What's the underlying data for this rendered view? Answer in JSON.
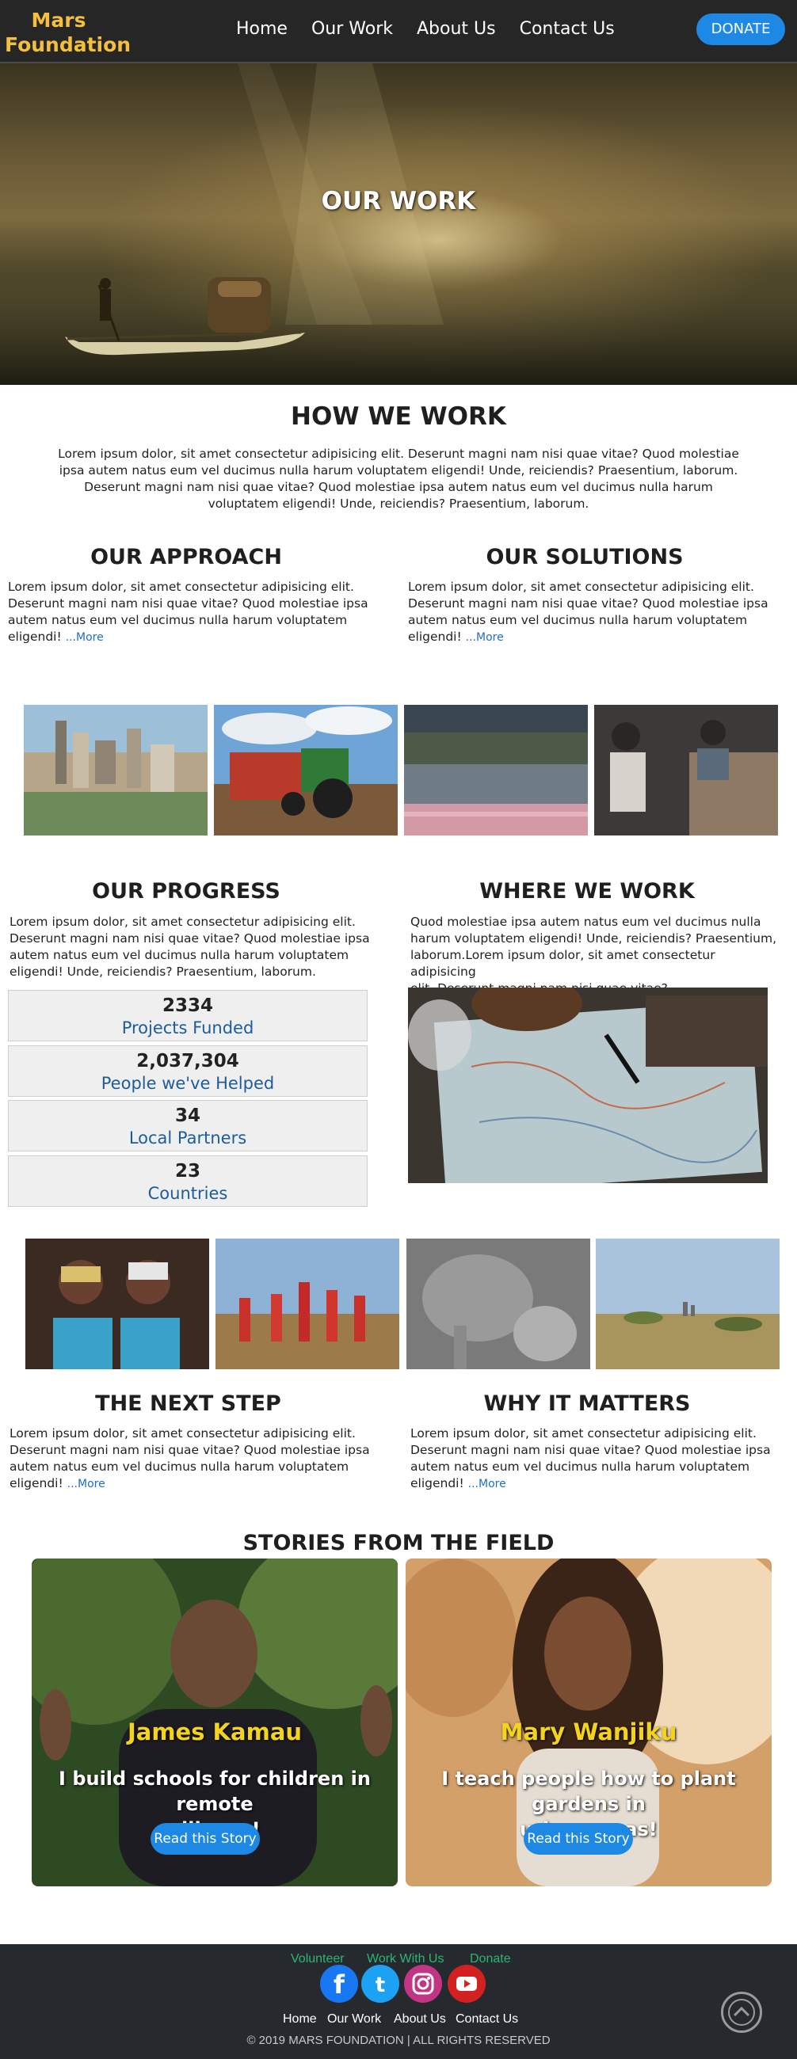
{
  "header": {
    "brand_line1": "Mars",
    "brand_line2": "Foundation",
    "nav": [
      "Home",
      "Our Work",
      "About Us",
      "Contact Us"
    ],
    "donate_label": "DONATE"
  },
  "hero": {
    "title": "OUR WORK"
  },
  "how_we_work": {
    "title": "HOW WE WORK",
    "lines": [
      "Lorem ipsum dolor, sit amet consectetur adipisicing elit. Deserunt magni nam nisi quae vitae? Quod molestiae",
      "ipsa autem natus eum vel ducimus nulla harum voluptatem eligendi! Unde, reiciendis? Praesentium, laborum.",
      "Deserunt magni nam nisi quae vitae? Quod molestiae ipsa autem natus eum vel ducimus nulla harum",
      "voluptatem eligendi! Unde, reiciendis? Praesentium, laborum."
    ]
  },
  "approach": {
    "title": "OUR APPROACH",
    "lines": [
      "Lorem ipsum dolor, sit amet consectetur adipisicing elit.",
      "Deserunt magni nam nisi quae vitae? Quod molestiae ipsa",
      "autem natus eum vel ducimus nulla harum voluptatem",
      "eligendi!"
    ],
    "more": "...More"
  },
  "solutions": {
    "title": "OUR SOLUTIONS",
    "lines": [
      "Lorem ipsum dolor, sit amet consectetur adipisicing elit.",
      "Deserunt magni nam nisi quae vitae? Quod molestiae ipsa",
      "autem natus eum vel ducimus nulla harum voluptatem",
      "eligendi!"
    ],
    "more": "...More"
  },
  "progress": {
    "title": "OUR PROGRESS",
    "lines": [
      "Lorem ipsum dolor, sit amet consectetur adipisicing elit.",
      "Deserunt magni nam nisi quae vitae? Quod molestiae ipsa",
      "autem natus eum vel ducimus nulla harum voluptatem",
      "eligendi! Unde, reiciendis? Praesentium, laborum."
    ],
    "stats": [
      {
        "value": "2334",
        "label": "Projects Funded"
      },
      {
        "value": "2,037,304",
        "label": "People we've Helped"
      },
      {
        "value": "34",
        "label": "Local Partners"
      },
      {
        "value": "23",
        "label": "Countries"
      }
    ]
  },
  "where": {
    "title": "WHERE WE WORK",
    "lines": [
      "Quod molestiae ipsa autem natus eum vel ducimus nulla",
      "harum voluptatem eligendi! Unde, reiciendis? Praesentium,",
      "laborum.Lorem ipsum dolor, sit amet consectetur adipisicing",
      "elit. Deserunt magni nam nisi quae vitae?"
    ]
  },
  "next_step": {
    "title": "THE NEXT STEP",
    "lines": [
      "Lorem ipsum dolor, sit amet consectetur adipisicing elit.",
      "Deserunt magni nam nisi quae vitae? Quod molestiae ipsa",
      "autem natus eum vel ducimus nulla harum voluptatem",
      "eligendi!"
    ],
    "more": "...More"
  },
  "why": {
    "title": "WHY IT MATTERS",
    "lines": [
      "Lorem ipsum dolor, sit amet consectetur adipisicing elit.",
      "Deserunt magni nam nisi quae vitae? Quod molestiae ipsa",
      "autem natus eum vel ducimus nulla harum voluptatem",
      "eligendi!"
    ],
    "more": "...More"
  },
  "stories": {
    "title": "STORIES FROM THE FIELD",
    "cards": [
      {
        "name": "James Kamau",
        "quote_line1": "I build schools for children in remote",
        "quote_line2": "villages!",
        "button": "Read this Story"
      },
      {
        "name": "Mary Wanjiku",
        "quote_line1": "I teach people how to plant gardens in",
        "quote_line2": "urban areas!",
        "button": "Read this Story"
      }
    ]
  },
  "footer": {
    "links": [
      "Volunteer",
      "Work With Us",
      "Donate"
    ],
    "social": [
      "facebook-icon",
      "twitter-icon",
      "instagram-icon",
      "youtube-icon"
    ],
    "nav": [
      "Home",
      "Our Work",
      "About Us",
      "Contact Us"
    ],
    "copyright": "© 2019 MARS FOUNDATION | ALL RIGHTS RESERVED"
  },
  "colors": {
    "accent": "#1e88e5",
    "brand": "#f4bf3a",
    "nav_bg": "#262626",
    "story_name": "#f4d31d",
    "footer_link": "#2bb673"
  }
}
